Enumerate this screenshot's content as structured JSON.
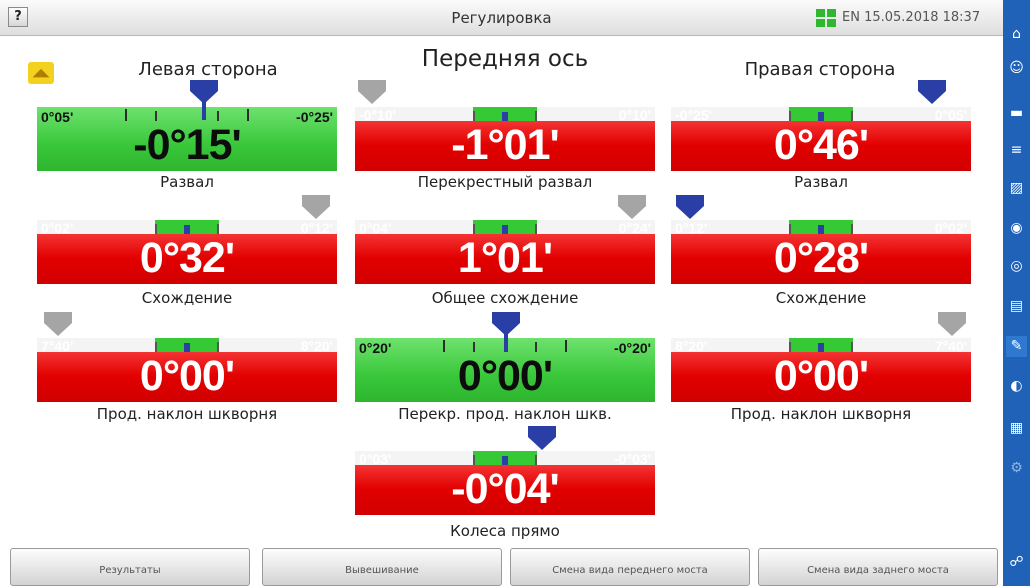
{
  "titlebar": {
    "help_label": "?",
    "title": "Регулировка",
    "lang_datetime": "EN 15.05.2018 18:37"
  },
  "headings": {
    "axis_title": "Передняя ось",
    "left_side": "Левая сторона",
    "right_side": "Правая сторона"
  },
  "gauges": [
    {
      "id": "left-camber",
      "label": "Развал",
      "value": "-0°15'",
      "min": "0°05'",
      "max": "-0°25'",
      "status": "green",
      "marker": "blue"
    },
    {
      "id": "cross-camber",
      "label": "Перекрестный развал",
      "value": "-1°01'",
      "min": "-0°10'",
      "max": "0°10'",
      "status": "red",
      "marker": "gray"
    },
    {
      "id": "right-camber",
      "label": "Развал",
      "value": "0°46'",
      "min": "-0°25'",
      "max": "0°05'",
      "status": "red",
      "marker": "blue"
    },
    {
      "id": "left-toe",
      "label": "Схождение",
      "value": "0°32'",
      "min": "0°02'",
      "max": "0°12'",
      "status": "red",
      "marker": "gray"
    },
    {
      "id": "total-toe",
      "label": "Общее схождение",
      "value": "1°01'",
      "min": "0°04'",
      "max": "0°24'",
      "status": "red",
      "marker": "gray"
    },
    {
      "id": "right-toe",
      "label": "Схождение",
      "value": "0°28'",
      "min": "0°12'",
      "max": "0°02'",
      "status": "red",
      "marker": "blue"
    },
    {
      "id": "left-caster",
      "label": "Прод. наклон шкворня",
      "value": "0°00'",
      "min": "7°40'",
      "max": "8°20'",
      "status": "red",
      "marker": "gray"
    },
    {
      "id": "cross-caster",
      "label": "Перекр. прод. наклон шкв.",
      "value": "0°00'",
      "min": "0°20'",
      "max": "-0°20'",
      "status": "green",
      "marker": "blue"
    },
    {
      "id": "right-caster",
      "label": "Прод. наклон шкворня",
      "value": "0°00'",
      "min": "8°20'",
      "max": "7°40'",
      "status": "red",
      "marker": "gray"
    },
    {
      "id": "straight-wheels",
      "label": "Колеса прямо",
      "value": "-0°04'",
      "min": "0°03'",
      "max": "-0°03'",
      "status": "red",
      "marker": "blue"
    }
  ],
  "bottom_buttons": [
    "Результаты",
    "Вывешивание",
    "Смена вида переднего моста",
    "Смена вида заднего моста"
  ],
  "sidebar_icons": [
    "home-icon",
    "user-icon",
    "car-icon",
    "list-icon",
    "image-icon",
    "wheel-icon",
    "tire-icon",
    "clipboard-icon",
    "wrench-icon",
    "adjust-icon",
    "calendar-icon",
    "settings-icon",
    "network-icon"
  ],
  "colors": {
    "out_of_range": "#e20000",
    "in_range": "#39c73a",
    "sidebar": "#1f62b8",
    "marker_blue": "#2a3fa6",
    "marker_gray": "#a5a5a5"
  }
}
